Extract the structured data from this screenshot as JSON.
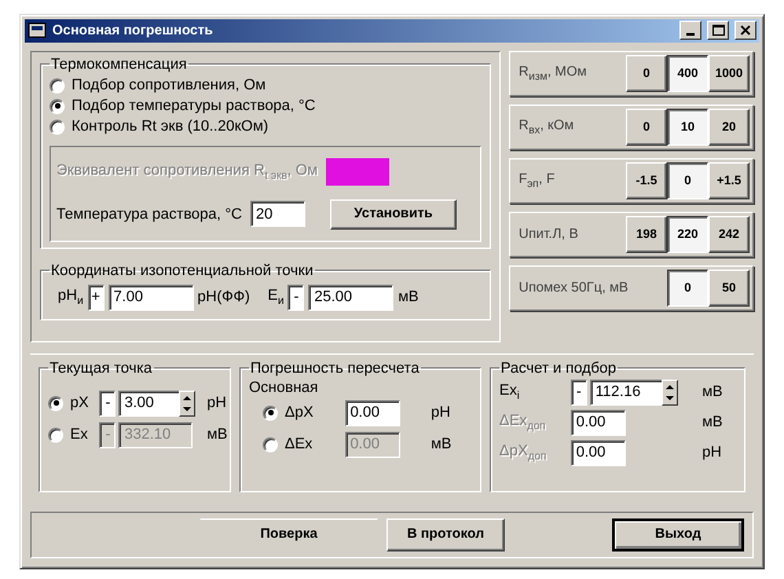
{
  "window": {
    "title": "Основная погрешность"
  },
  "thermo": {
    "title": "Термокомпенсация",
    "options": [
      {
        "label": "Подбор сопротивления, Ом",
        "selected": false
      },
      {
        "label": "Подбор температуры раствора, °С",
        "selected": true
      },
      {
        "label": "Контроль Rt экв (10..20кОм)",
        "selected": false
      }
    ],
    "equiv": {
      "label": "Эквивалент сопротивления R$_{t экв}$, Ом",
      "disabled": true,
      "color": "#e010e0"
    },
    "temp": {
      "label": "Температура раствора, °С",
      "value": "20"
    },
    "set_button": "Установить"
  },
  "isopotential": {
    "title": "Координаты изопотенциальной точки",
    "fields": [
      {
        "label": "pH$_{и}$",
        "sign": "+",
        "value": "7.00",
        "unit": "pH(ФФ)"
      },
      {
        "label": "E$_{и}$",
        "sign": "-",
        "value": "25.00",
        "unit": "мВ"
      }
    ]
  },
  "params": [
    {
      "label": "R$_{изм}$, МОм",
      "options": [
        {
          "label": "0",
          "selected": false
        },
        {
          "label": "400",
          "selected": true
        },
        {
          "label": "1000",
          "selected": false
        }
      ]
    },
    {
      "label": "R$_{вх}$, кОм",
      "options": [
        {
          "label": "0",
          "selected": false
        },
        {
          "label": "10",
          "selected": true
        },
        {
          "label": "20",
          "selected": false
        }
      ]
    },
    {
      "label": "F$_{эп}$, F",
      "options": [
        {
          "label": "-1.5",
          "selected": false
        },
        {
          "label": "0",
          "selected": true
        },
        {
          "label": "+1.5",
          "selected": false
        }
      ]
    },
    {
      "label": "Uпит.Л, В",
      "options": [
        {
          "label": "198",
          "selected": false
        },
        {
          "label": "220",
          "selected": true
        },
        {
          "label": "242",
          "selected": false
        }
      ]
    },
    {
      "label": "Uпомех 50Гц, мВ",
      "options": [
        {
          "label": "0",
          "selected": true
        },
        {
          "label": "50",
          "selected": false
        }
      ]
    }
  ],
  "current": {
    "title": "Текущая точка",
    "rows": [
      {
        "label": "pX",
        "selected": true,
        "sign": "-",
        "value": "3.00",
        "unit": "pH",
        "spin": true,
        "disabled": false
      },
      {
        "label": "Ex",
        "selected": false,
        "sign": "-",
        "value": "332.10",
        "unit": "мВ",
        "spin": false,
        "disabled": true
      }
    ]
  },
  "error": {
    "title": "Погрешность пересчета",
    "subtitle": "Основная",
    "rows": [
      {
        "label": "ΔpX",
        "selected": true,
        "value": "0.00",
        "unit": "pH",
        "disabled": false
      },
      {
        "label": "ΔEx",
        "selected": false,
        "value": "0.00",
        "unit": "мВ",
        "disabled": true
      }
    ]
  },
  "calc": {
    "title": "Расчет и подбор",
    "rows": [
      {
        "label": "Ex$_{i}$",
        "sign": "-",
        "value": "112.16",
        "unit": "мВ",
        "spin": true,
        "disabled": false
      },
      {
        "label": "ΔEx$_{доп}$",
        "value": "0.00",
        "unit": "мВ",
        "spin": false,
        "disabled": true
      },
      {
        "label": "ΔpX$_{доп}$",
        "value": "0.00",
        "unit": "pH",
        "spin": false,
        "disabled": true
      }
    ]
  },
  "footer": {
    "buttons": [
      {
        "label": "Поверка",
        "kind": "flat"
      },
      {
        "label": "В протокол",
        "kind": "raised"
      },
      {
        "label": "Выход",
        "kind": "default"
      }
    ]
  }
}
